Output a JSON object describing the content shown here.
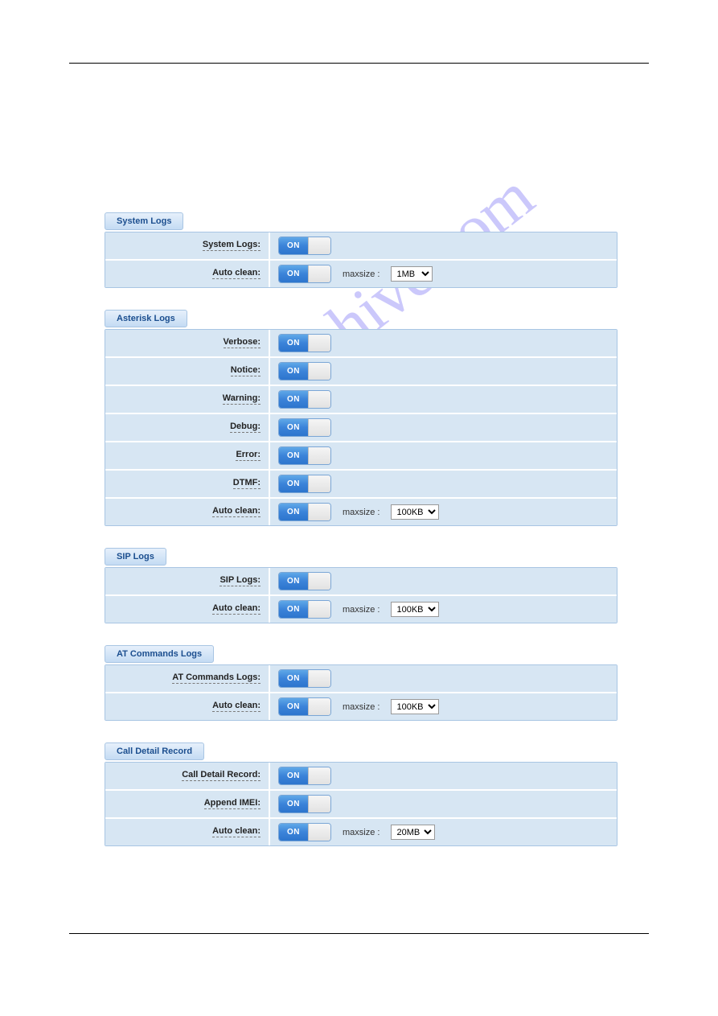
{
  "watermark": "manualshive.com",
  "toggle_text": "ON",
  "maxsize_label": "maxsize :",
  "sections": [
    {
      "title": "System Logs",
      "rows": [
        {
          "label": "System Logs:",
          "toggle": true
        },
        {
          "label": "Auto clean:",
          "toggle": true,
          "select": "1MB"
        }
      ]
    },
    {
      "title": "Asterisk Logs",
      "rows": [
        {
          "label": "Verbose:",
          "toggle": true
        },
        {
          "label": "Notice:",
          "toggle": true
        },
        {
          "label": "Warning:",
          "toggle": true
        },
        {
          "label": "Debug:",
          "toggle": true
        },
        {
          "label": "Error:",
          "toggle": true
        },
        {
          "label": "DTMF:",
          "toggle": true
        },
        {
          "label": "Auto clean:",
          "toggle": true,
          "select": "100KB"
        }
      ]
    },
    {
      "title": "SIP Logs",
      "rows": [
        {
          "label": "SIP Logs:",
          "toggle": true
        },
        {
          "label": "Auto clean:",
          "toggle": true,
          "select": "100KB"
        }
      ]
    },
    {
      "title": "AT Commands Logs",
      "rows": [
        {
          "label": "AT Commands Logs:",
          "toggle": true
        },
        {
          "label": "Auto clean:",
          "toggle": true,
          "select": "100KB"
        }
      ]
    },
    {
      "title": "Call Detail Record",
      "rows": [
        {
          "label": "Call Detail Record:",
          "toggle": true
        },
        {
          "label": "Append IMEI:",
          "toggle": true
        },
        {
          "label": "Auto clean:",
          "toggle": true,
          "select": "20MB"
        }
      ]
    }
  ]
}
